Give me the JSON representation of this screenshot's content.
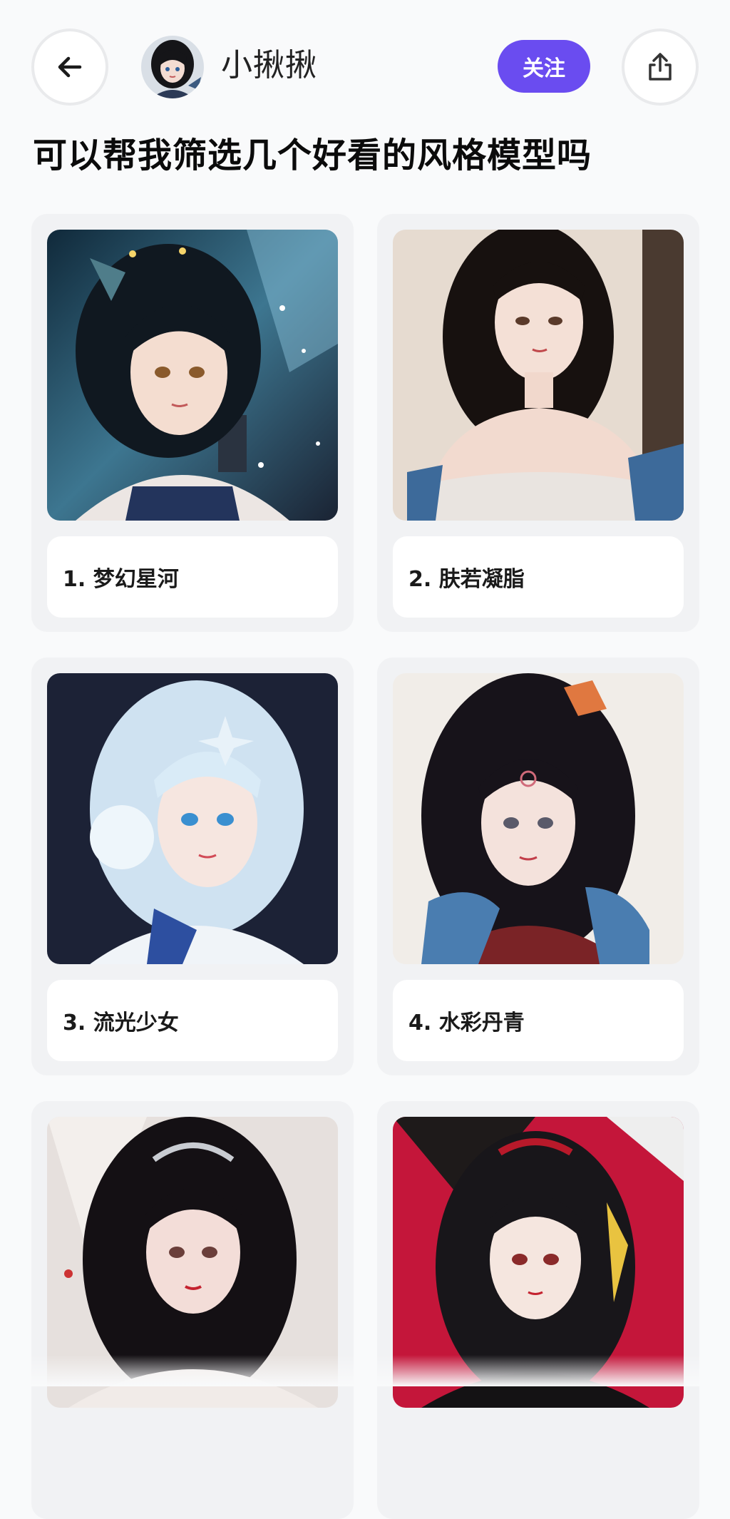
{
  "header": {
    "back_icon": "arrow-left-icon",
    "username": "小揪揪",
    "follow_label": "关注",
    "share_icon": "share-icon"
  },
  "page_title": "可以帮我筛选几个好看的风格模型吗",
  "cards": [
    {
      "label": "1. 梦幻星河",
      "palette": [
        "#0d2a3a",
        "#3a6d86",
        "#e9d5c3"
      ]
    },
    {
      "label": "2. 肤若凝脂",
      "palette": [
        "#e9ddd0",
        "#1a1414",
        "#f2d6cb"
      ]
    },
    {
      "label": "3. 流光少女",
      "palette": [
        "#1c2236",
        "#cfe3f2",
        "#ffffff"
      ]
    },
    {
      "label": "4. 水彩丹青",
      "palette": [
        "#f2eee9",
        "#1b1518",
        "#8a2b2b"
      ]
    },
    {
      "label": "",
      "palette": [
        "#e8e2df",
        "#141014",
        "#f0d7d3"
      ]
    },
    {
      "label": "",
      "palette": [
        "#c4163a",
        "#18161a",
        "#f3e3dc"
      ]
    }
  ]
}
